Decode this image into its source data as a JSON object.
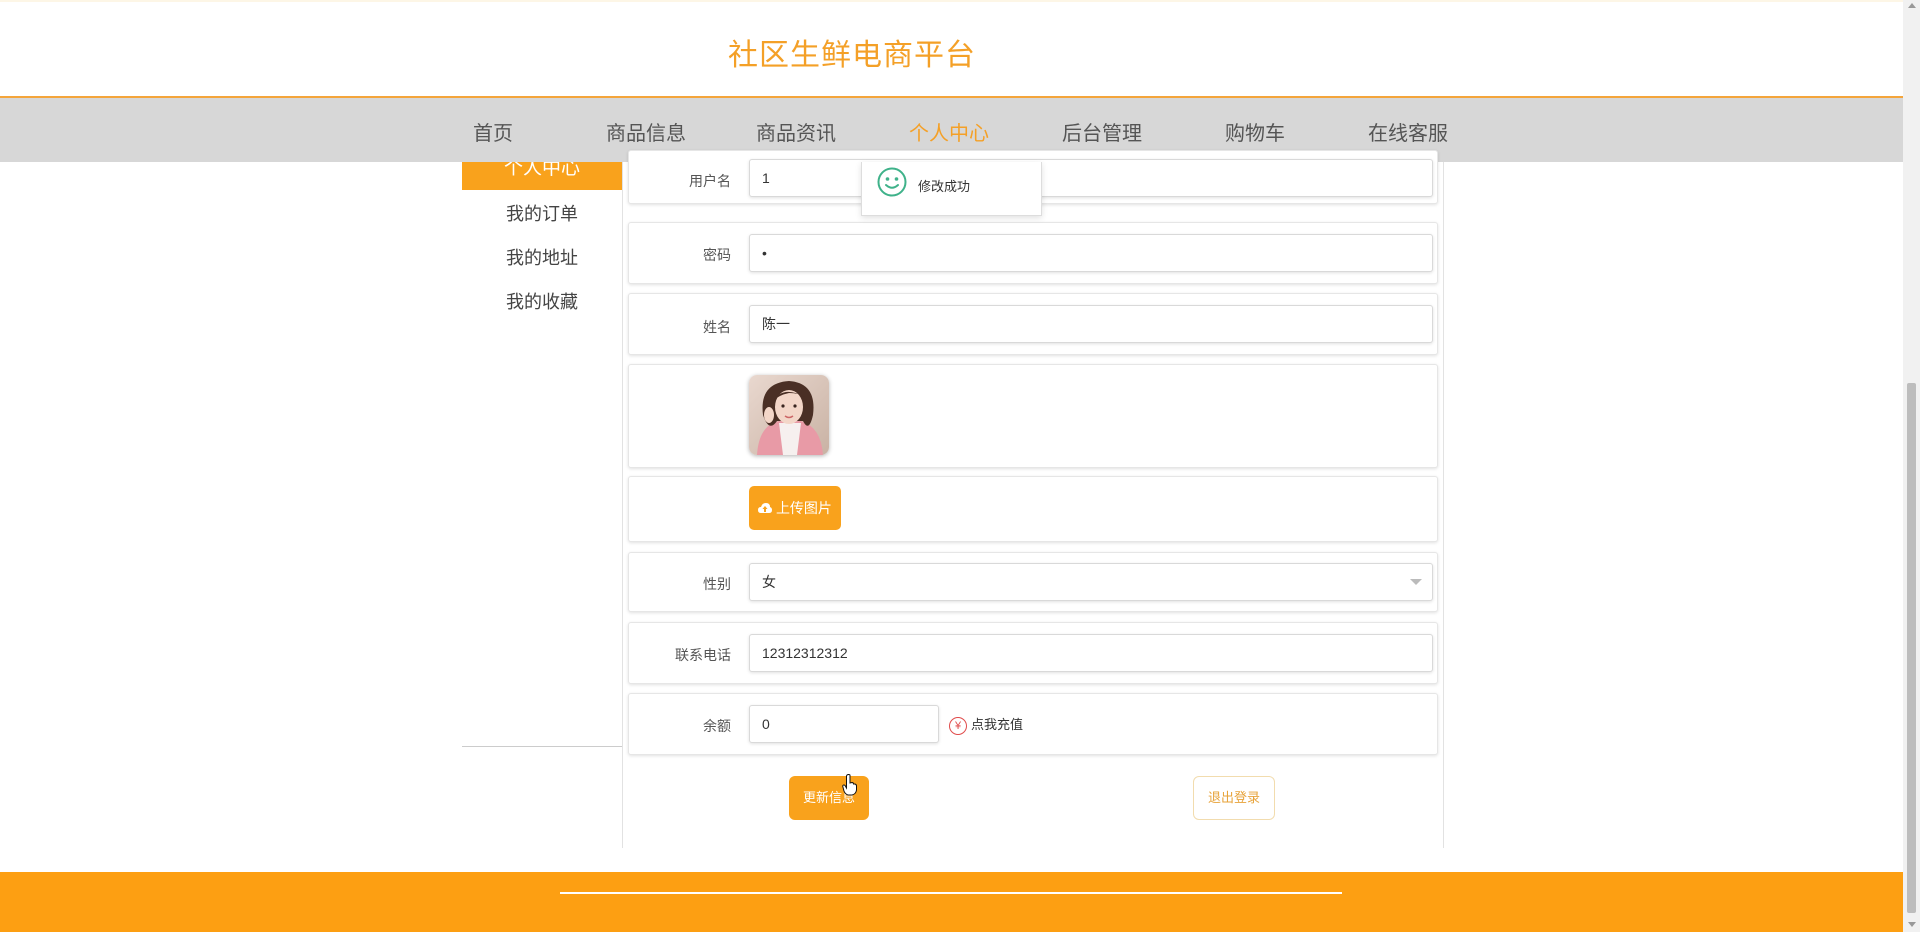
{
  "header": {
    "title": "社区生鲜电商平台"
  },
  "nav": {
    "items": [
      {
        "label": "首页"
      },
      {
        "label": "商品信息"
      },
      {
        "label": "商品资讯"
      },
      {
        "label": "个人中心",
        "active": true
      },
      {
        "label": "后台管理"
      },
      {
        "label": "购物车"
      },
      {
        "label": "在线客服"
      }
    ]
  },
  "sidebar": {
    "header": "个人中心",
    "items": [
      {
        "label": "我的订单"
      },
      {
        "label": "我的地址"
      },
      {
        "label": "我的收藏"
      }
    ]
  },
  "form": {
    "username": {
      "label": "用户名",
      "value": "1"
    },
    "password": {
      "label": "密码",
      "value": "•"
    },
    "name": {
      "label": "姓名",
      "value": "陈一"
    },
    "upload_label": "上传图片",
    "gender": {
      "label": "性别",
      "value": "女"
    },
    "phone": {
      "label": "联系电话",
      "value": "12312312312"
    },
    "balance": {
      "label": "余额",
      "value": "0",
      "recharge_label": "点我充值"
    },
    "update_label": "更新信息",
    "logout_label": "退出登录"
  },
  "toast": {
    "message": "修改成功"
  },
  "colors": {
    "accent": "#f9a21c",
    "footer": "#fd9f12",
    "nav_bg": "#d7d7d7"
  }
}
